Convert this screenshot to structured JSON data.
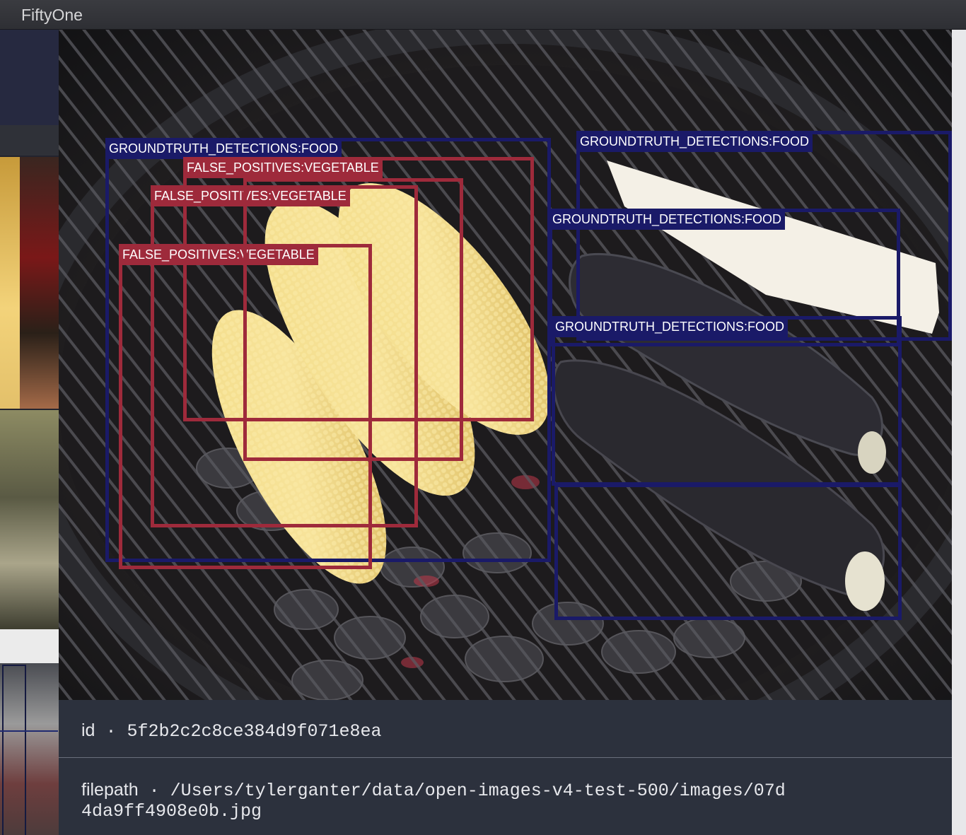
{
  "app": {
    "title": "FiftyOne"
  },
  "detections": {
    "ground_truth_label": "GROUNDTRUTH_DETECTIONS:FOOD",
    "false_positive_label": "FALSE_POSITIVES:VEGETABLE"
  },
  "sample": {
    "id_key": "id",
    "id_value": "5f2b2c2c8ce384d9f071e8ea",
    "filepath_key": "filepath",
    "filepath_value": "/Users/tylerganter/data/open-images-v4-test-500/images/07d4da9ff4908e0b.jpg"
  },
  "colors": {
    "ground_truth": "#1a1a68",
    "false_positive": "#9e2a3b",
    "info_background": "#2c313d"
  }
}
